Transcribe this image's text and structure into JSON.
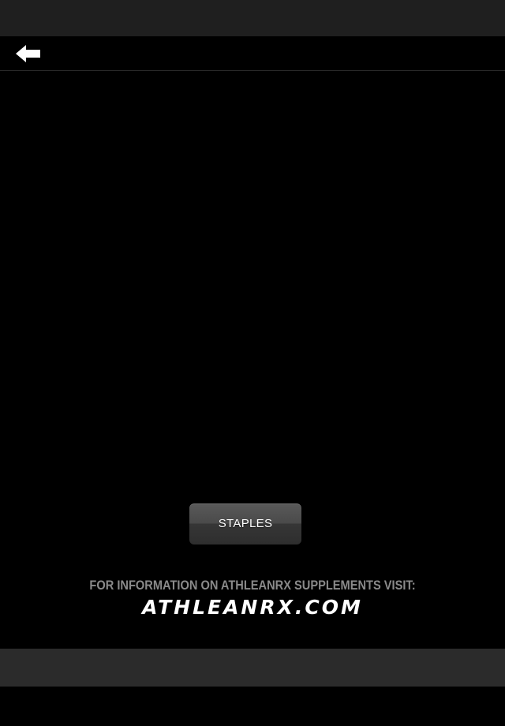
{
  "nav": {
    "back_icon": "back-arrow-icon"
  },
  "main": {
    "button_label": "STAPLES",
    "info_text": "FOR INFORMATION ON ATHLEANRX SUPPLEMENTS VISIT:",
    "site_link": "ATHLEANRX.COM"
  },
  "colors": {
    "background": "#000000",
    "status_bar": "#1f1f1f",
    "bottom_bar": "#2b2b2b",
    "button": "#3e3e3e",
    "info_text": "#8a8a8a",
    "link_text": "#ffffff"
  }
}
